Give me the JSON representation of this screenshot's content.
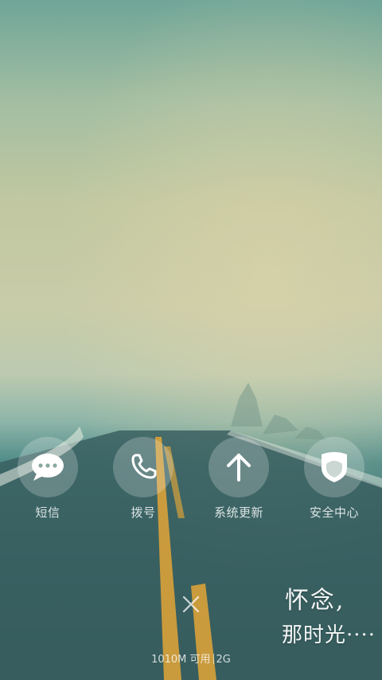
{
  "apps": [
    {
      "label": "短信",
      "icon": "chat-bubble-icon"
    },
    {
      "label": "拨号",
      "icon": "phone-icon"
    },
    {
      "label": "系统更新",
      "icon": "arrow-up-icon"
    },
    {
      "label": "安全中心",
      "icon": "shield-icon"
    }
  ],
  "status": {
    "memory": "1010M 可用",
    "network": "2G"
  },
  "poem": {
    "line1": "怀念,",
    "line2": "那时光····"
  },
  "colors": {
    "icon_bg": "rgba(255,255,255,0.22)",
    "label": "#ffffff",
    "road_line": "#d9a23a"
  }
}
